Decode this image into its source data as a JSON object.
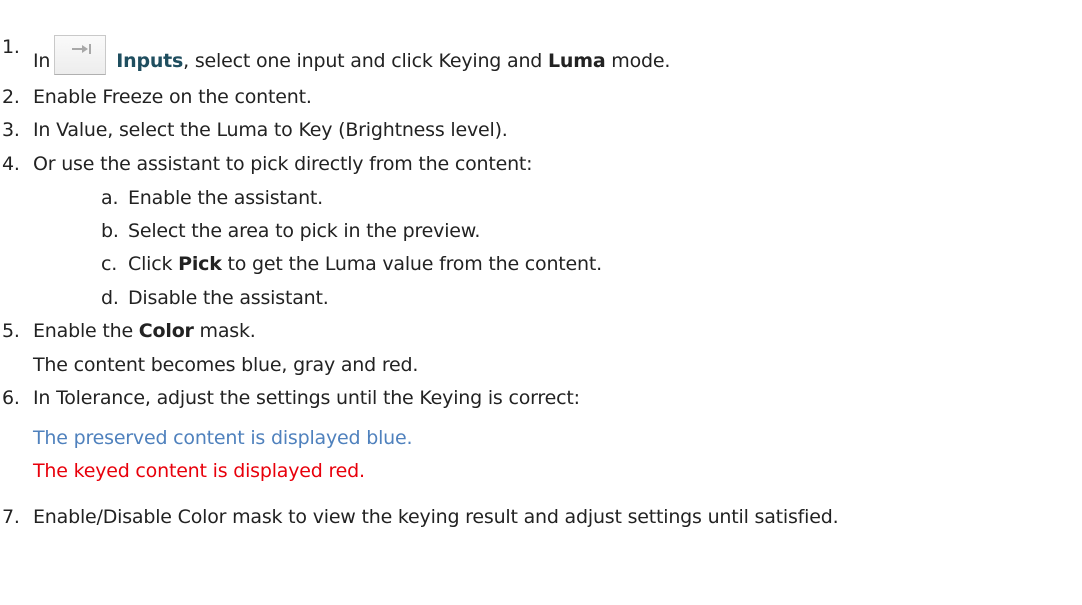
{
  "steps": [
    {
      "num": "1.",
      "pre": "In",
      "icon": "inputs-icon",
      "keyword": "Inputs",
      "mid": ", select one input and click Keying and ",
      "bold": "Luma",
      "post": " mode."
    },
    {
      "num": "2.",
      "text": "Enable Freeze on the content."
    },
    {
      "num": "3.",
      "text": "In Value, select the Luma to Key (Brightness level)."
    },
    {
      "num": "4.",
      "text": "Or use the assistant to pick directly from the content:"
    },
    {
      "num": "5.",
      "pre": "Enable the ",
      "bold": "Color",
      "post": " mask.",
      "cont": "The content becomes blue, gray and red."
    },
    {
      "num": "6.",
      "text": "In Tolerance, adjust the settings until the Keying is correct:",
      "blue_note": "The preserved content is displayed blue.",
      "red_note": "The keyed content is displayed red."
    },
    {
      "num": "7.",
      "text": "Enable/Disable Color mask to view the keying result and adjust settings until satisfied."
    }
  ],
  "substeps": [
    {
      "letter": "a.",
      "text": "Enable the assistant."
    },
    {
      "letter": "b.",
      "text": "Select the area to pick in the preview."
    },
    {
      "letter": "c.",
      "pre": "Click ",
      "bold": "Pick",
      "post": " to get the Luma value from the content."
    },
    {
      "letter": "d.",
      "text": "Disable the assistant."
    }
  ],
  "colors": {
    "keyword": "#1f4e5f",
    "blue_note": "#4f81bd",
    "red_note": "#e8000b"
  }
}
